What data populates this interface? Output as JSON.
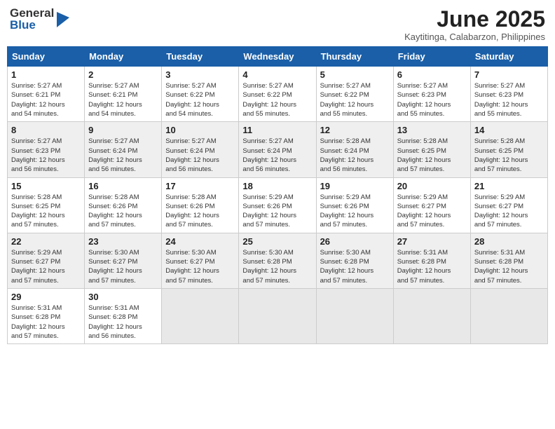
{
  "header": {
    "logo_general": "General",
    "logo_blue": "Blue",
    "month_title": "June 2025",
    "location": "Kaytitinga, Calabarzon, Philippines"
  },
  "weekdays": [
    "Sunday",
    "Monday",
    "Tuesday",
    "Wednesday",
    "Thursday",
    "Friday",
    "Saturday"
  ],
  "weeks": [
    [
      {
        "day": "1",
        "info": "Sunrise: 5:27 AM\nSunset: 6:21 PM\nDaylight: 12 hours\nand 54 minutes."
      },
      {
        "day": "2",
        "info": "Sunrise: 5:27 AM\nSunset: 6:21 PM\nDaylight: 12 hours\nand 54 minutes."
      },
      {
        "day": "3",
        "info": "Sunrise: 5:27 AM\nSunset: 6:22 PM\nDaylight: 12 hours\nand 54 minutes."
      },
      {
        "day": "4",
        "info": "Sunrise: 5:27 AM\nSunset: 6:22 PM\nDaylight: 12 hours\nand 55 minutes."
      },
      {
        "day": "5",
        "info": "Sunrise: 5:27 AM\nSunset: 6:22 PM\nDaylight: 12 hours\nand 55 minutes."
      },
      {
        "day": "6",
        "info": "Sunrise: 5:27 AM\nSunset: 6:23 PM\nDaylight: 12 hours\nand 55 minutes."
      },
      {
        "day": "7",
        "info": "Sunrise: 5:27 AM\nSunset: 6:23 PM\nDaylight: 12 hours\nand 55 minutes."
      }
    ],
    [
      {
        "day": "8",
        "info": "Sunrise: 5:27 AM\nSunset: 6:23 PM\nDaylight: 12 hours\nand 56 minutes."
      },
      {
        "day": "9",
        "info": "Sunrise: 5:27 AM\nSunset: 6:24 PM\nDaylight: 12 hours\nand 56 minutes."
      },
      {
        "day": "10",
        "info": "Sunrise: 5:27 AM\nSunset: 6:24 PM\nDaylight: 12 hours\nand 56 minutes."
      },
      {
        "day": "11",
        "info": "Sunrise: 5:27 AM\nSunset: 6:24 PM\nDaylight: 12 hours\nand 56 minutes."
      },
      {
        "day": "12",
        "info": "Sunrise: 5:28 AM\nSunset: 6:24 PM\nDaylight: 12 hours\nand 56 minutes."
      },
      {
        "day": "13",
        "info": "Sunrise: 5:28 AM\nSunset: 6:25 PM\nDaylight: 12 hours\nand 57 minutes."
      },
      {
        "day": "14",
        "info": "Sunrise: 5:28 AM\nSunset: 6:25 PM\nDaylight: 12 hours\nand 57 minutes."
      }
    ],
    [
      {
        "day": "15",
        "info": "Sunrise: 5:28 AM\nSunset: 6:25 PM\nDaylight: 12 hours\nand 57 minutes."
      },
      {
        "day": "16",
        "info": "Sunrise: 5:28 AM\nSunset: 6:26 PM\nDaylight: 12 hours\nand 57 minutes."
      },
      {
        "day": "17",
        "info": "Sunrise: 5:28 AM\nSunset: 6:26 PM\nDaylight: 12 hours\nand 57 minutes."
      },
      {
        "day": "18",
        "info": "Sunrise: 5:29 AM\nSunset: 6:26 PM\nDaylight: 12 hours\nand 57 minutes."
      },
      {
        "day": "19",
        "info": "Sunrise: 5:29 AM\nSunset: 6:26 PM\nDaylight: 12 hours\nand 57 minutes."
      },
      {
        "day": "20",
        "info": "Sunrise: 5:29 AM\nSunset: 6:27 PM\nDaylight: 12 hours\nand 57 minutes."
      },
      {
        "day": "21",
        "info": "Sunrise: 5:29 AM\nSunset: 6:27 PM\nDaylight: 12 hours\nand 57 minutes."
      }
    ],
    [
      {
        "day": "22",
        "info": "Sunrise: 5:29 AM\nSunset: 6:27 PM\nDaylight: 12 hours\nand 57 minutes."
      },
      {
        "day": "23",
        "info": "Sunrise: 5:30 AM\nSunset: 6:27 PM\nDaylight: 12 hours\nand 57 minutes."
      },
      {
        "day": "24",
        "info": "Sunrise: 5:30 AM\nSunset: 6:27 PM\nDaylight: 12 hours\nand 57 minutes."
      },
      {
        "day": "25",
        "info": "Sunrise: 5:30 AM\nSunset: 6:28 PM\nDaylight: 12 hours\nand 57 minutes."
      },
      {
        "day": "26",
        "info": "Sunrise: 5:30 AM\nSunset: 6:28 PM\nDaylight: 12 hours\nand 57 minutes."
      },
      {
        "day": "27",
        "info": "Sunrise: 5:31 AM\nSunset: 6:28 PM\nDaylight: 12 hours\nand 57 minutes."
      },
      {
        "day": "28",
        "info": "Sunrise: 5:31 AM\nSunset: 6:28 PM\nDaylight: 12 hours\nand 57 minutes."
      }
    ],
    [
      {
        "day": "29",
        "info": "Sunrise: 5:31 AM\nSunset: 6:28 PM\nDaylight: 12 hours\nand 57 minutes."
      },
      {
        "day": "30",
        "info": "Sunrise: 5:31 AM\nSunset: 6:28 PM\nDaylight: 12 hours\nand 56 minutes."
      },
      {
        "day": "",
        "info": ""
      },
      {
        "day": "",
        "info": ""
      },
      {
        "day": "",
        "info": ""
      },
      {
        "day": "",
        "info": ""
      },
      {
        "day": "",
        "info": ""
      }
    ]
  ]
}
